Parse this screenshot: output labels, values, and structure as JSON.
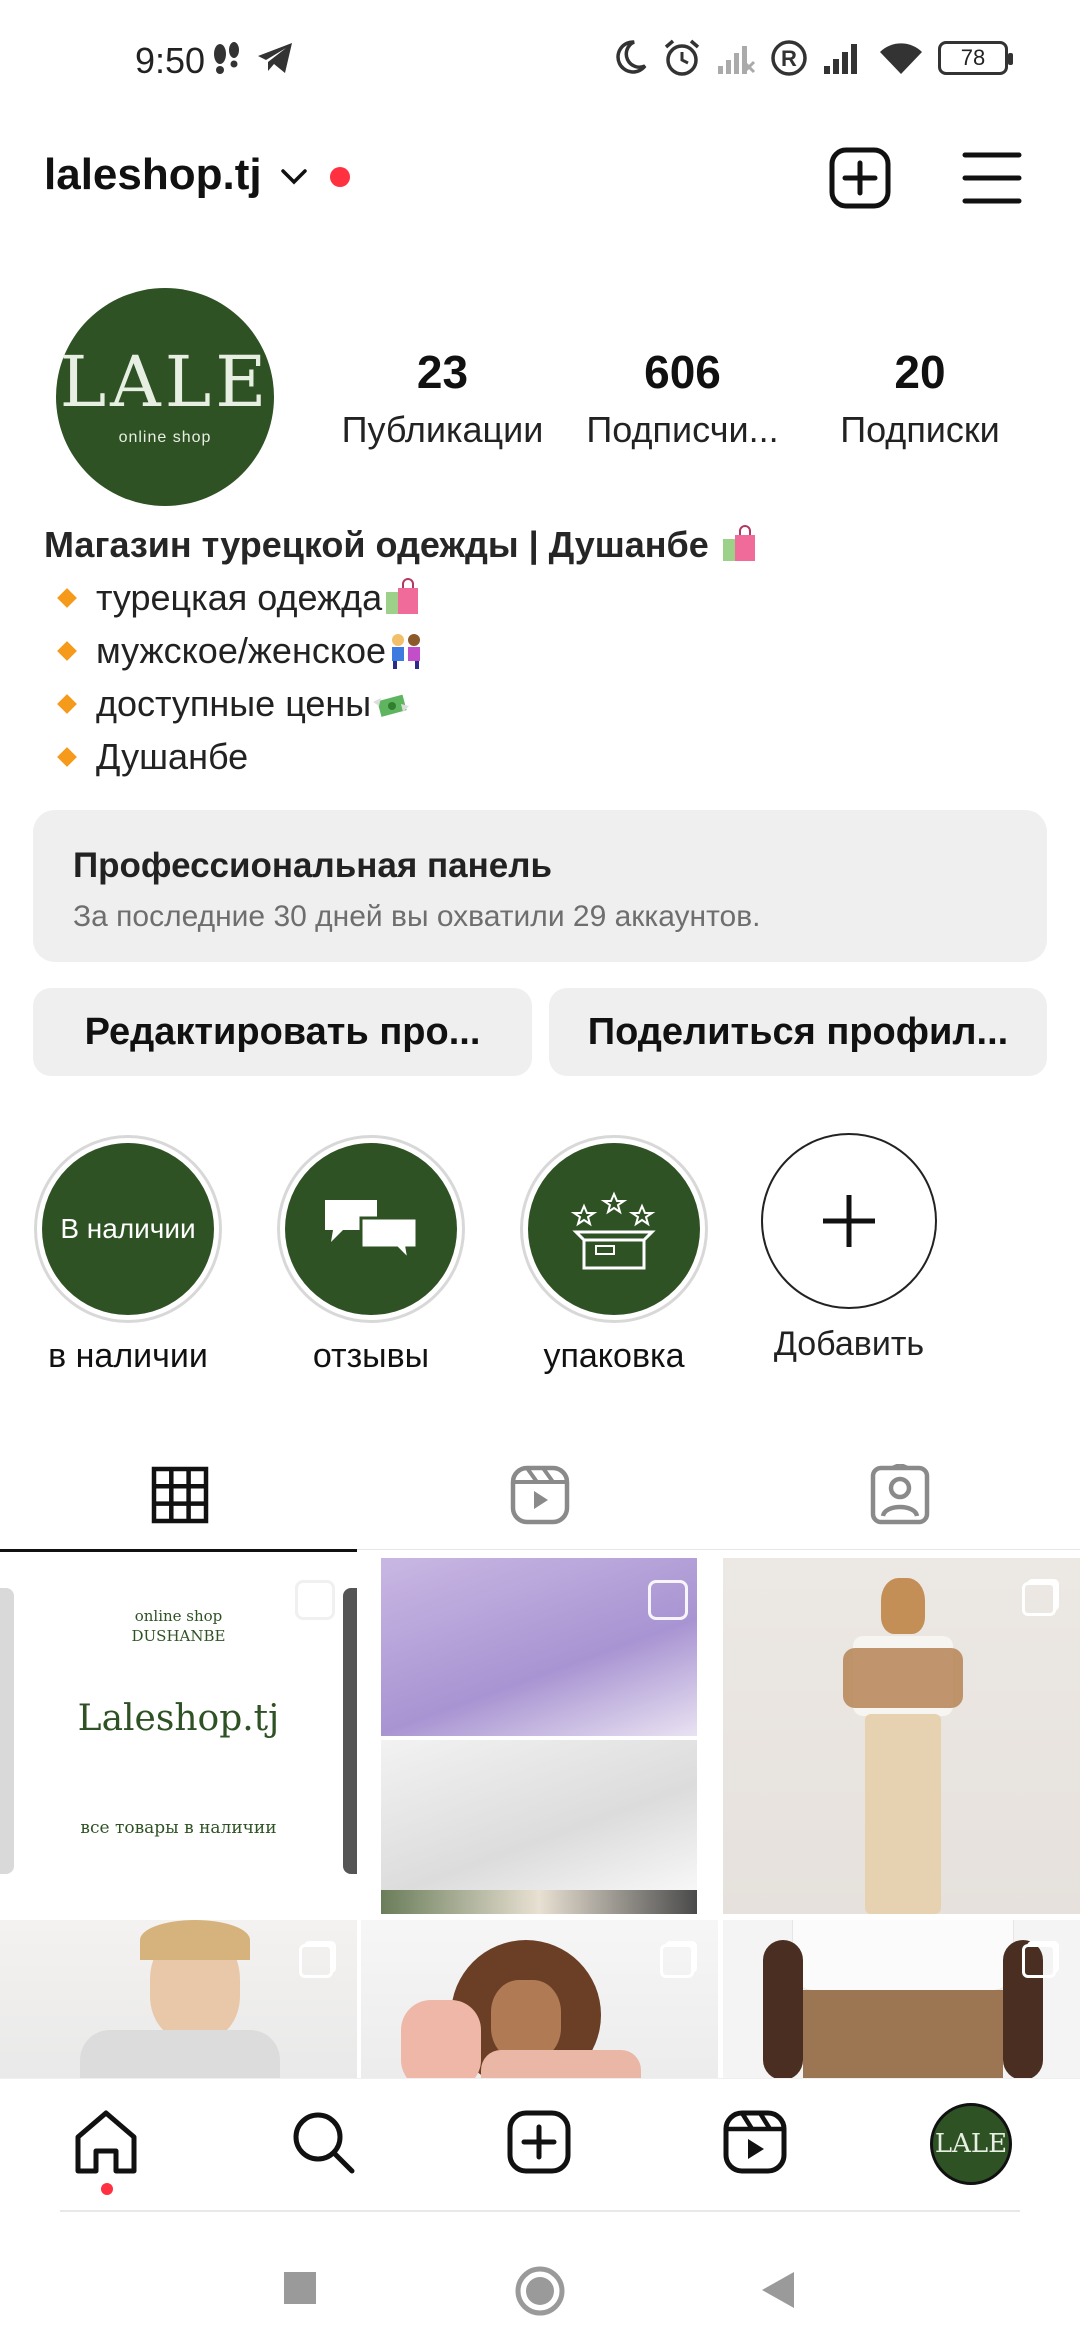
{
  "status_bar": {
    "time": "9:50",
    "battery": "78"
  },
  "header": {
    "username": "laleshop.tj"
  },
  "profile": {
    "avatar_logo": "LALE",
    "avatar_sub": "online shop",
    "stats": [
      {
        "value": "23",
        "label": "Публикации"
      },
      {
        "value": "606",
        "label": "Подписчи..."
      },
      {
        "value": "20",
        "label": "Подписки"
      }
    ],
    "bio_title": "Магазин турецкой одежды | Душанбе",
    "bio_lines": [
      "турецкая одежда",
      "мужское/женское",
      "доступные цены",
      "Душанбе"
    ]
  },
  "panel": {
    "title": "Профессиональная панель",
    "subtitle": "За последние 30 дней вы охватили 29 аккаунтов."
  },
  "buttons": {
    "edit": "Редактировать про...",
    "share": "Поделиться профил..."
  },
  "highlights": [
    {
      "label": "в наличии",
      "cover_text": "В наличии"
    },
    {
      "label": "отзывы"
    },
    {
      "label": "упаковка"
    },
    {
      "label": "Добавить"
    }
  ],
  "posts": {
    "post1": {
      "line1": "online shop",
      "line2": "DUSHANBE",
      "title": "Laleshop.tj",
      "footer": "все товары в наличии"
    }
  },
  "colors": {
    "brand_green": "#2f5225",
    "panel_bg": "#efefef",
    "notification_red": "#ff3040"
  }
}
